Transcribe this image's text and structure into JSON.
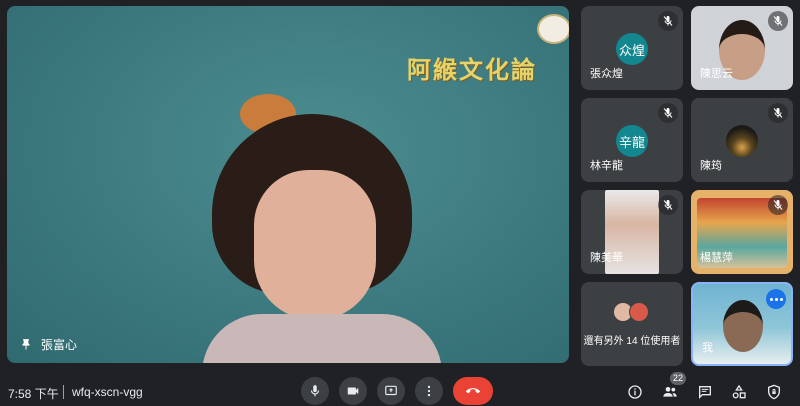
{
  "main": {
    "speaker_name": "張富心",
    "banner_text": "阿緱文化論"
  },
  "tiles": [
    {
      "name": "張众煌",
      "initials": "众煌"
    },
    {
      "name": "陳思云"
    },
    {
      "name": "林辛龍",
      "initials": "辛龍"
    },
    {
      "name": "陳筠"
    },
    {
      "name": "陳美華"
    },
    {
      "name": "楊慧萍"
    },
    {
      "others_text": "還有另外 14 位使用者"
    },
    {
      "name": "我"
    }
  ],
  "bottom_bar": {
    "time": "7:58 下午",
    "meeting_code": "wfq-xscn-vgg",
    "participant_count": "22"
  },
  "colors": {
    "background": "#202124",
    "tile": "#3c4043",
    "avatar_teal": "#12878f",
    "leave_red": "#ea4335",
    "accent_blue": "#1a73e8"
  }
}
